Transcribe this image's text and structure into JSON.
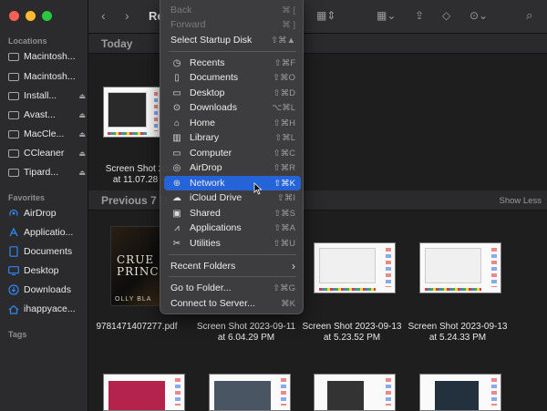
{
  "window": {
    "title_partial": "Re"
  },
  "sidebar": {
    "locations_header": "Locations",
    "favorites_header": "Favorites",
    "tags_header": "Tags",
    "locations": [
      {
        "label": "Macintosh...",
        "eject": false
      },
      {
        "label": "Macintosh...",
        "eject": false
      },
      {
        "label": "Install...",
        "eject": true
      },
      {
        "label": "Avast...",
        "eject": true
      },
      {
        "label": "MacCle...",
        "eject": true
      },
      {
        "label": "CCleaner",
        "eject": true
      },
      {
        "label": "Tipard...",
        "eject": true
      }
    ],
    "favorites": [
      {
        "label": "AirDrop",
        "icon": "airdrop-icon"
      },
      {
        "label": "Applicatio...",
        "icon": "applications-icon"
      },
      {
        "label": "Documents",
        "icon": "document-icon"
      },
      {
        "label": "Desktop",
        "icon": "desktop-icon"
      },
      {
        "label": "Downloads",
        "icon": "downloads-icon"
      },
      {
        "label": "ihappyace...",
        "icon": "home-icon"
      }
    ],
    "eject_glyph": "⏏"
  },
  "content": {
    "today_label": "Today",
    "previous_label": "Previous 7 D",
    "show_less": "Show Less",
    "today_file": {
      "line1": "Screen Shot 202",
      "line2": "at 11.07.28 A"
    },
    "files": [
      {
        "line1": "9781471407277.pdf",
        "line2": ""
      },
      {
        "line1": "Screen Shot 2023-09-11",
        "line2": "at 6.04.29 PM"
      },
      {
        "line1": "Screen Shot 2023-09-13",
        "line2": "at 5.23.52 PM"
      },
      {
        "line1": "Screen Shot 2023-09-13",
        "line2": "at 5.24.33 PM"
      }
    ],
    "book_text": [
      "CRUE",
      "PRINC",
      "OLLY BLA"
    ]
  },
  "menu": {
    "items": [
      {
        "label": "Back",
        "shortcut": "⌘ [",
        "dim": true
      },
      {
        "label": "Forward",
        "shortcut": "⌘ ]",
        "dim": true
      },
      {
        "label": "Select Startup Disk",
        "shortcut": "⇧⌘▲",
        "dim": false
      },
      {
        "label": "Recents",
        "shortcut": "⇧⌘F",
        "icon": "🕘"
      },
      {
        "label": "Documents",
        "shortcut": "⇧⌘O",
        "icon": "📄"
      },
      {
        "label": "Desktop",
        "shortcut": "⇧⌘D",
        "icon": "▭"
      },
      {
        "label": "Downloads",
        "shortcut": "⌥⌘L",
        "icon": "⊙"
      },
      {
        "label": "Home",
        "shortcut": "⇧⌘H",
        "icon": "⌂"
      },
      {
        "label": "Library",
        "shortcut": "⇧⌘L",
        "icon": "▥"
      },
      {
        "label": "Computer",
        "shortcut": "⇧⌘C",
        "icon": "▭"
      },
      {
        "label": "AirDrop",
        "shortcut": "⇧⌘R",
        "icon": "◎"
      },
      {
        "label": "Network",
        "shortcut": "⇧⌘K",
        "icon": "🌐",
        "highlighted": true
      },
      {
        "label": "iCloud Drive",
        "shortcut": "⇧⌘I",
        "icon": "☁"
      },
      {
        "label": "Shared",
        "shortcut": "⇧⌘S",
        "icon": "▣"
      },
      {
        "label": "Applications",
        "shortcut": "⇧⌘A",
        "icon": "✕"
      },
      {
        "label": "Utilities",
        "shortcut": "⇧⌘U",
        "icon": "✂"
      },
      {
        "label": "Recent Folders",
        "shortcut": "›"
      },
      {
        "label": "Go to Folder...",
        "shortcut": "⇧⌘G"
      },
      {
        "label": "Connect to Server...",
        "shortcut": "⌘K"
      }
    ]
  },
  "colors": {
    "accent": "#2463d8",
    "red": "#fe5f57",
    "yellow": "#febc2e",
    "green": "#28c840",
    "favorite_blue": "#2f87f5"
  }
}
